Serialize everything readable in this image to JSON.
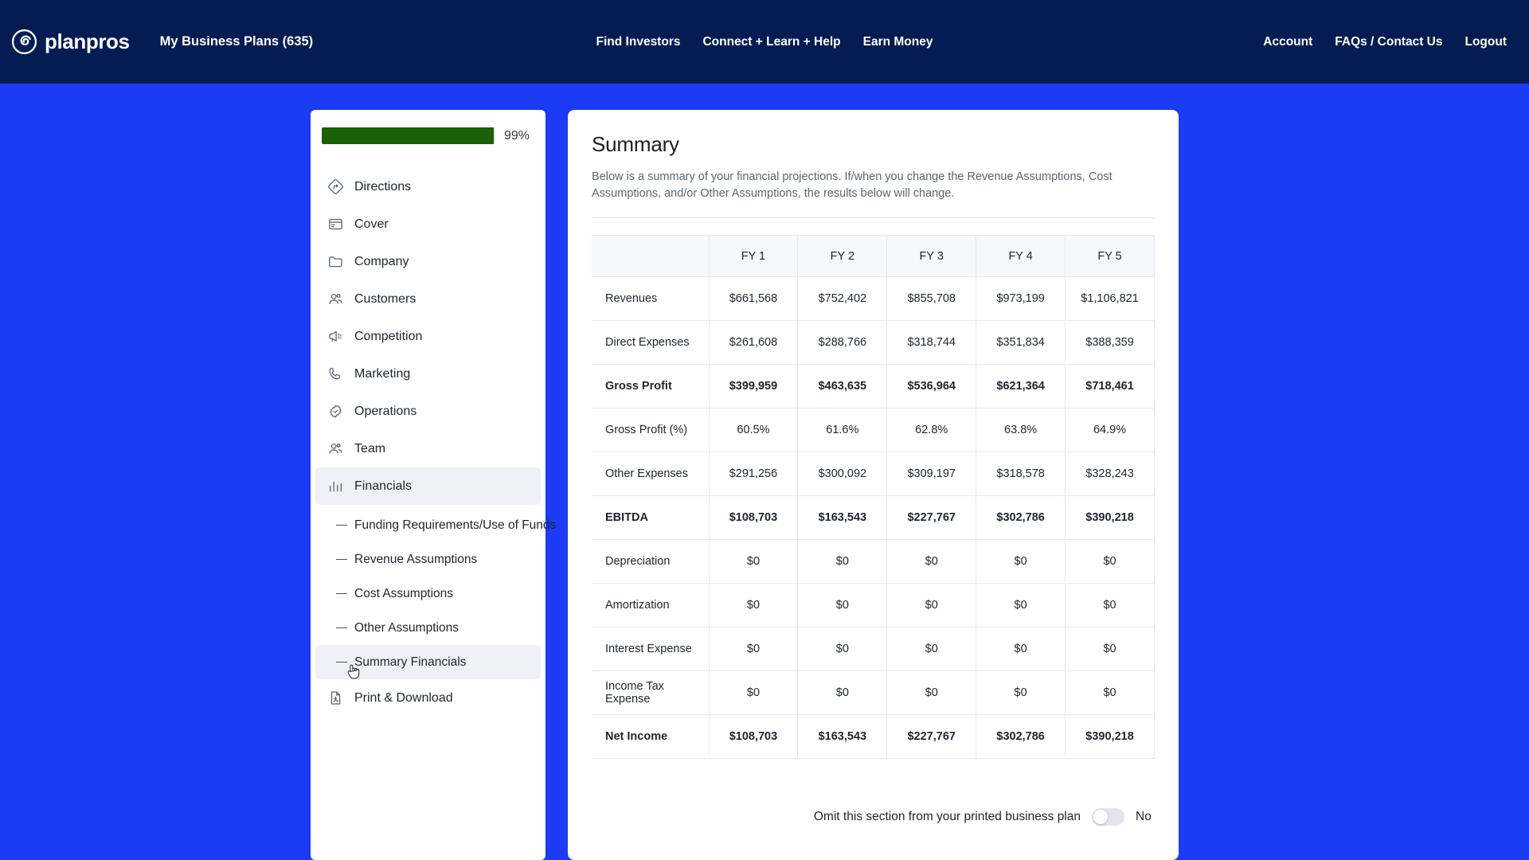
{
  "brand": {
    "name": "planpros",
    "mark_icon": "spiral-logo-icon"
  },
  "header": {
    "plan_title": "My Business Plans (635)",
    "center_links": [
      {
        "label": "Find Investors"
      },
      {
        "label": "Connect + Learn + Help"
      },
      {
        "label": "Earn Money"
      }
    ],
    "right_links": [
      {
        "label": "Account"
      },
      {
        "label": "FAQs / Contact Us"
      },
      {
        "label": "Logout"
      }
    ]
  },
  "sidebar": {
    "progress": {
      "percent_label": "99%",
      "percent_value": 99,
      "fill_color": "#1a6007"
    },
    "items": [
      {
        "label": "Directions",
        "icon": "directions-diamond-icon",
        "active": false
      },
      {
        "label": "Cover",
        "icon": "cover-card-icon",
        "active": false
      },
      {
        "label": "Company",
        "icon": "folder-icon",
        "active": false
      },
      {
        "label": "Customers",
        "icon": "users-icon",
        "active": false
      },
      {
        "label": "Competition",
        "icon": "megaphone-icon",
        "active": false
      },
      {
        "label": "Marketing",
        "icon": "phone-icon",
        "active": false
      },
      {
        "label": "Operations",
        "icon": "gear-check-icon",
        "active": false
      },
      {
        "label": "Team",
        "icon": "users-icon",
        "active": false
      },
      {
        "label": "Financials",
        "icon": "bar-chart-icon",
        "active": true
      }
    ],
    "subitems": [
      {
        "label": "Funding Requirements/Use of Funds",
        "active": false
      },
      {
        "label": "Revenue Assumptions",
        "active": false
      },
      {
        "label": "Cost Assumptions",
        "active": false
      },
      {
        "label": "Other Assumptions",
        "active": false
      },
      {
        "label": "Summary Financials",
        "active": true
      }
    ],
    "footer_item": {
      "label": "Print & Download",
      "icon": "pdf-file-icon"
    }
  },
  "main": {
    "title": "Summary",
    "description": "Below is a summary of your financial projections. If/when you change the Revenue Assumptions, Cost Assumptions, and/or Other Assumptions, the results below will change.",
    "omit": {
      "label": "Omit this section from your printed business plan",
      "state": "No",
      "checked": false
    }
  },
  "chart_data": {
    "type": "table",
    "title": "Summary",
    "columns": [
      "",
      "FY 1",
      "FY 2",
      "FY 3",
      "FY 4",
      "FY 5"
    ],
    "rows": [
      {
        "label": "Revenues",
        "bold": false,
        "values": [
          "$661,568",
          "$752,402",
          "$855,708",
          "$973,199",
          "$1,106,821"
        ]
      },
      {
        "label": "Direct Expenses",
        "bold": false,
        "values": [
          "$261,608",
          "$288,766",
          "$318,744",
          "$351,834",
          "$388,359"
        ]
      },
      {
        "label": "Gross Profit",
        "bold": true,
        "values": [
          "$399,959",
          "$463,635",
          "$536,964",
          "$621,364",
          "$718,461"
        ]
      },
      {
        "label": "Gross Profit (%)",
        "bold": false,
        "values": [
          "60.5%",
          "61.6%",
          "62.8%",
          "63.8%",
          "64.9%"
        ]
      },
      {
        "label": "Other Expenses",
        "bold": false,
        "values": [
          "$291,256",
          "$300,092",
          "$309,197",
          "$318,578",
          "$328,243"
        ]
      },
      {
        "label": "EBITDA",
        "bold": true,
        "values": [
          "$108,703",
          "$163,543",
          "$227,767",
          "$302,786",
          "$390,218"
        ]
      },
      {
        "label": "Depreciation",
        "bold": false,
        "values": [
          "$0",
          "$0",
          "$0",
          "$0",
          "$0"
        ]
      },
      {
        "label": "Amortization",
        "bold": false,
        "values": [
          "$0",
          "$0",
          "$0",
          "$0",
          "$0"
        ]
      },
      {
        "label": "Interest Expense",
        "bold": false,
        "values": [
          "$0",
          "$0",
          "$0",
          "$0",
          "$0"
        ]
      },
      {
        "label": "Income Tax Expense",
        "bold": false,
        "values": [
          "$0",
          "$0",
          "$0",
          "$0",
          "$0"
        ]
      },
      {
        "label": "Net Income",
        "bold": true,
        "values": [
          "$108,703",
          "$163,543",
          "$227,767",
          "$302,786",
          "$390,218"
        ]
      }
    ]
  },
  "colors": {
    "navbar": "#041c52",
    "page_background": "#1b3bf5",
    "card": "#ffffff",
    "active_item": "#eef1f8",
    "progress_green": "#1a6007"
  }
}
